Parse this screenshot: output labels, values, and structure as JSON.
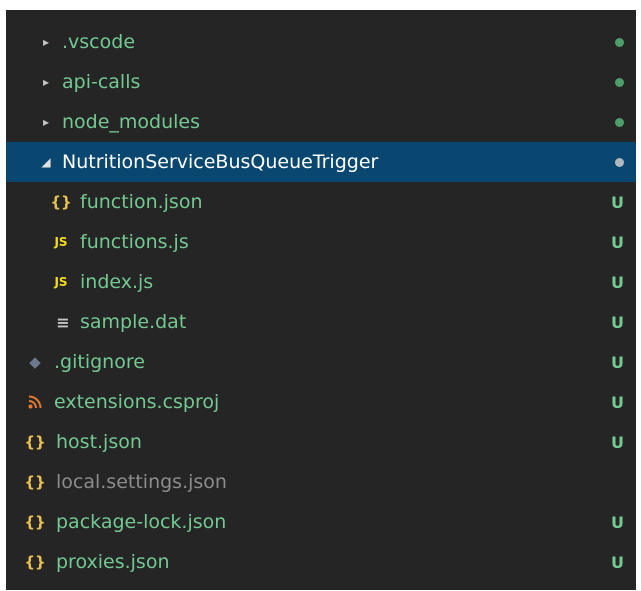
{
  "colors": {
    "background": "#252526",
    "selected_background": "#094771",
    "untracked_green": "#73c991",
    "ignored_gray": "#8c8c8c",
    "dot_green": "#4f9d6a",
    "json_yellow": "#e8c04f",
    "js_yellow": "#f5de19",
    "rss_orange": "#e37933",
    "git_icon_gray": "#6b7a8a",
    "text_icon_gray": "#c5c5c5"
  },
  "explorer": {
    "items": [
      {
        "label": ".vscode",
        "icon": "chevron-right-icon",
        "status": "•"
      },
      {
        "label": "api-calls",
        "icon": "chevron-right-icon",
        "status": "•"
      },
      {
        "label": "node_modules",
        "icon": "chevron-right-icon",
        "status": "•"
      },
      {
        "label": "NutritionServiceBusQueueTrigger",
        "icon": "chevron-down-icon",
        "status": "•"
      },
      {
        "label": "function.json",
        "icon": "json-braces-icon",
        "icon_text": "{}",
        "status": "U"
      },
      {
        "label": "functions.js",
        "icon": "javascript-icon",
        "icon_text": "JS",
        "status": "U"
      },
      {
        "label": "index.js",
        "icon": "javascript-icon",
        "icon_text": "JS",
        "status": "U"
      },
      {
        "label": "sample.dat",
        "icon": "text-file-icon",
        "icon_text": "≡",
        "status": "U"
      },
      {
        "label": ".gitignore",
        "icon": "git-icon",
        "icon_text": "◆",
        "status": "U"
      },
      {
        "label": "extensions.csproj",
        "icon": "rss-icon",
        "icon_text": "͡",
        "status": "U"
      },
      {
        "label": "host.json",
        "icon": "json-braces-icon",
        "icon_text": "{}",
        "status": "U"
      },
      {
        "label": "local.settings.json",
        "icon": "json-braces-icon",
        "icon_text": "{}",
        "status": ""
      },
      {
        "label": "package-lock.json",
        "icon": "json-braces-icon",
        "icon_text": "{}",
        "status": "U"
      },
      {
        "label": "proxies.json",
        "icon": "json-braces-icon",
        "icon_text": "{}",
        "status": "U"
      }
    ]
  }
}
